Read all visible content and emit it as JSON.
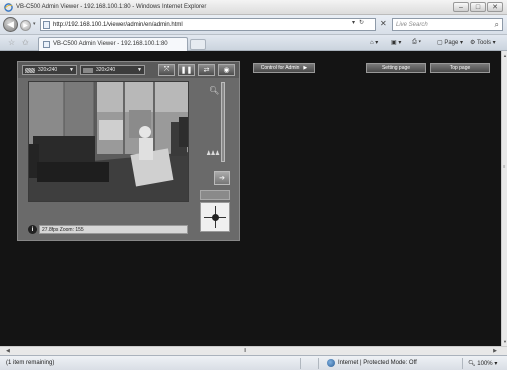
{
  "window": {
    "title": "VB-C500 Admin Viewer - 192.168.100.1:80 - Windows Internet Explorer",
    "controls": {
      "minimize": "–",
      "maximize": "□",
      "close": "✕"
    }
  },
  "address_bar": {
    "url": "http://192.168.100.1/viewer/admin/en/admin.html",
    "search_placeholder": "Live Search"
  },
  "tab": {
    "label": "VB-C500 Admin Viewer - 192.168.100.1:80"
  },
  "command_bar": {
    "page": "Page",
    "tools": "Tools"
  },
  "viewer": {
    "resolution_select_1": "320x240",
    "resolution_select_2": "320x240",
    "status_text": "27.8fps Zoom: 155",
    "buttons": [
      "fit-to-screen",
      "pause",
      "swap",
      "full"
    ]
  },
  "buttons": {
    "control_for_admin": "Control for Admin",
    "setting_page": "Setting page",
    "top_page": "Top page"
  },
  "statusbar": {
    "message": "(1 item remaining)",
    "zone": "Internet | Protected Mode: Off",
    "zoom": "100%"
  },
  "colors": {
    "content_bg": "#141414",
    "panel_bg": "#6a6a6a",
    "chrome": "#dfe5ec"
  }
}
